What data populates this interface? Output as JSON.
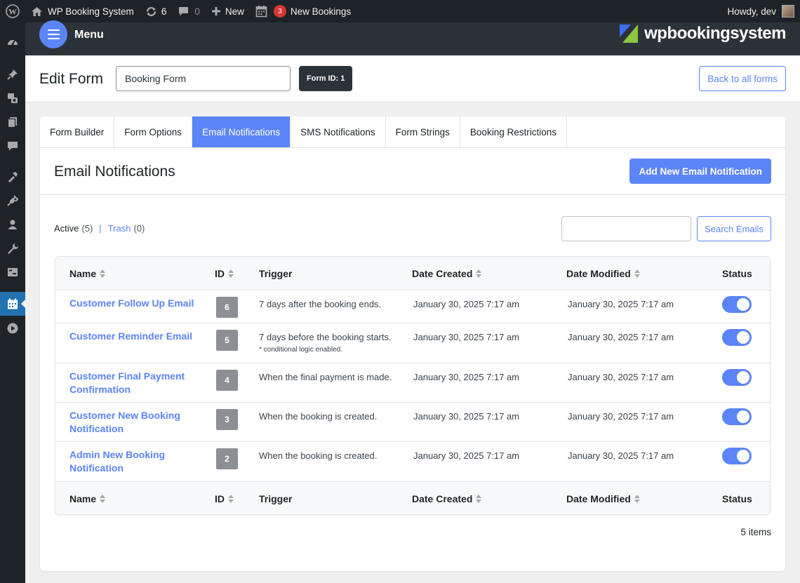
{
  "admin_bar": {
    "site_name": "WP Booking System",
    "updates_count": "6",
    "comments_count": "0",
    "new_label": "New",
    "bookings_badge": "3",
    "bookings_label": "New Bookings",
    "howdy": "Howdy, dev"
  },
  "plugin_header": {
    "menu_label": "Menu",
    "brand": "wpbookingsystem"
  },
  "edit_form": {
    "title": "Edit Form",
    "form_name_value": "Booking Form",
    "form_id_label": "Form ID: 1",
    "back_label": "Back to all forms"
  },
  "tabs": [
    {
      "label": "Form Builder",
      "active": false
    },
    {
      "label": "Form Options",
      "active": false
    },
    {
      "label": "Email Notifications",
      "active": true
    },
    {
      "label": "SMS Notifications",
      "active": false
    },
    {
      "label": "Form Strings",
      "active": false
    },
    {
      "label": "Booking Restrictions",
      "active": false
    }
  ],
  "section": {
    "title": "Email Notifications",
    "add_button": "Add New Email Notification"
  },
  "filters": {
    "active_label": "Active",
    "active_count": "(5)",
    "separator": "|",
    "trash_label": "Trash",
    "trash_count": "(0)"
  },
  "search": {
    "value": "",
    "button_label": "Search Emails"
  },
  "table": {
    "columns": {
      "name": "Name",
      "id": "ID",
      "trigger": "Trigger",
      "date_created": "Date Created",
      "date_modified": "Date Modified",
      "status": "Status"
    },
    "rows": [
      {
        "name": "Customer Follow Up Email",
        "id": "6",
        "trigger": "7 days after the booking ends.",
        "note": "",
        "date_created": "January 30, 2025 7:17 am",
        "date_modified": "January 30, 2025 7:17 am",
        "status_on": true
      },
      {
        "name": "Customer Reminder Email",
        "id": "5",
        "trigger": "7 days before the booking starts.",
        "note": "* conditional logic enabled.",
        "date_created": "January 30, 2025 7:17 am",
        "date_modified": "January 30, 2025 7:17 am",
        "status_on": true
      },
      {
        "name": "Customer Final Payment Confirmation",
        "id": "4",
        "trigger": "When the final payment is made.",
        "note": "",
        "date_created": "January 30, 2025 7:17 am",
        "date_modified": "January 30, 2025 7:17 am",
        "status_on": true
      },
      {
        "name": "Customer New Booking Notification",
        "id": "3",
        "trigger": "When the booking is created.",
        "note": "",
        "date_created": "January 30, 2025 7:17 am",
        "date_modified": "January 30, 2025 7:17 am",
        "status_on": true
      },
      {
        "name": "Admin New Booking Notification",
        "id": "2",
        "trigger": "When the booking is created.",
        "note": "",
        "date_created": "January 30, 2025 7:17 am",
        "date_modified": "January 30, 2025 7:17 am",
        "status_on": true
      }
    ]
  },
  "items_count": "5 items",
  "colors": {
    "accent": "#5b85f7",
    "admin_bar": "#1d2327",
    "brand_green": "#8dc63f",
    "brand_blue": "#3d6df2"
  }
}
